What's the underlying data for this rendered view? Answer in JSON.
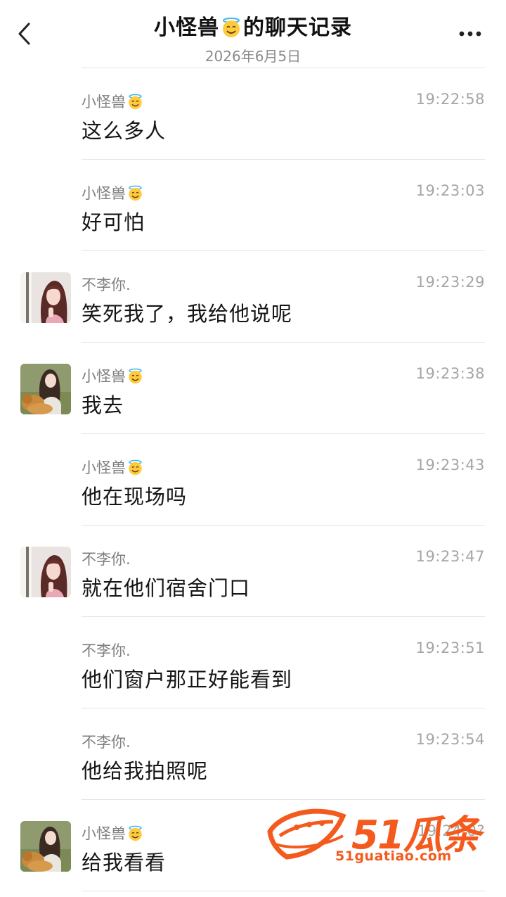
{
  "header": {
    "title_prefix": "小怪兽",
    "title_suffix": "的聊天记录",
    "title_emoji": "smiling-face-with-halo",
    "date": "2026年6月5日"
  },
  "messages": [
    {
      "sender": "小怪兽",
      "sender_emoji": "smiling-face-with-halo",
      "time": "19:22:58",
      "text": "这么多人",
      "avatar": "none"
    },
    {
      "sender": "小怪兽",
      "sender_emoji": "smiling-face-with-halo",
      "time": "19:23:03",
      "text": "好可怕",
      "avatar": "none"
    },
    {
      "sender": "不李你.",
      "sender_emoji": "",
      "time": "19:23:29",
      "text": "笑死我了，我给他说呢",
      "avatar": "girl-pink"
    },
    {
      "sender": "小怪兽",
      "sender_emoji": "smiling-face-with-halo",
      "time": "19:23:38",
      "text": "我去",
      "avatar": "girl-dog"
    },
    {
      "sender": "小怪兽",
      "sender_emoji": "smiling-face-with-halo",
      "time": "19:23:43",
      "text": "他在现场吗",
      "avatar": "none"
    },
    {
      "sender": "不李你.",
      "sender_emoji": "",
      "time": "19:23:47",
      "text": "就在他们宿舍门口",
      "avatar": "girl-pink"
    },
    {
      "sender": "不李你.",
      "sender_emoji": "",
      "time": "19:23:51",
      "text": "他们窗户那正好能看到",
      "avatar": "none"
    },
    {
      "sender": "不李你.",
      "sender_emoji": "",
      "time": "19:23:54",
      "text": "他给我拍照呢",
      "avatar": "none"
    },
    {
      "sender": "小怪兽",
      "sender_emoji": "smiling-face-with-halo",
      "time": "19:24:0?",
      "text": "给我看看",
      "avatar": "girl-dog"
    }
  ],
  "watermark": {
    "name": "51瓜条",
    "url": "51guatiao.com",
    "color": "#f45a1e"
  },
  "colors": {
    "sender": "#7f7f7f",
    "time": "#a5a5a5",
    "divider": "#e4e4e4"
  }
}
